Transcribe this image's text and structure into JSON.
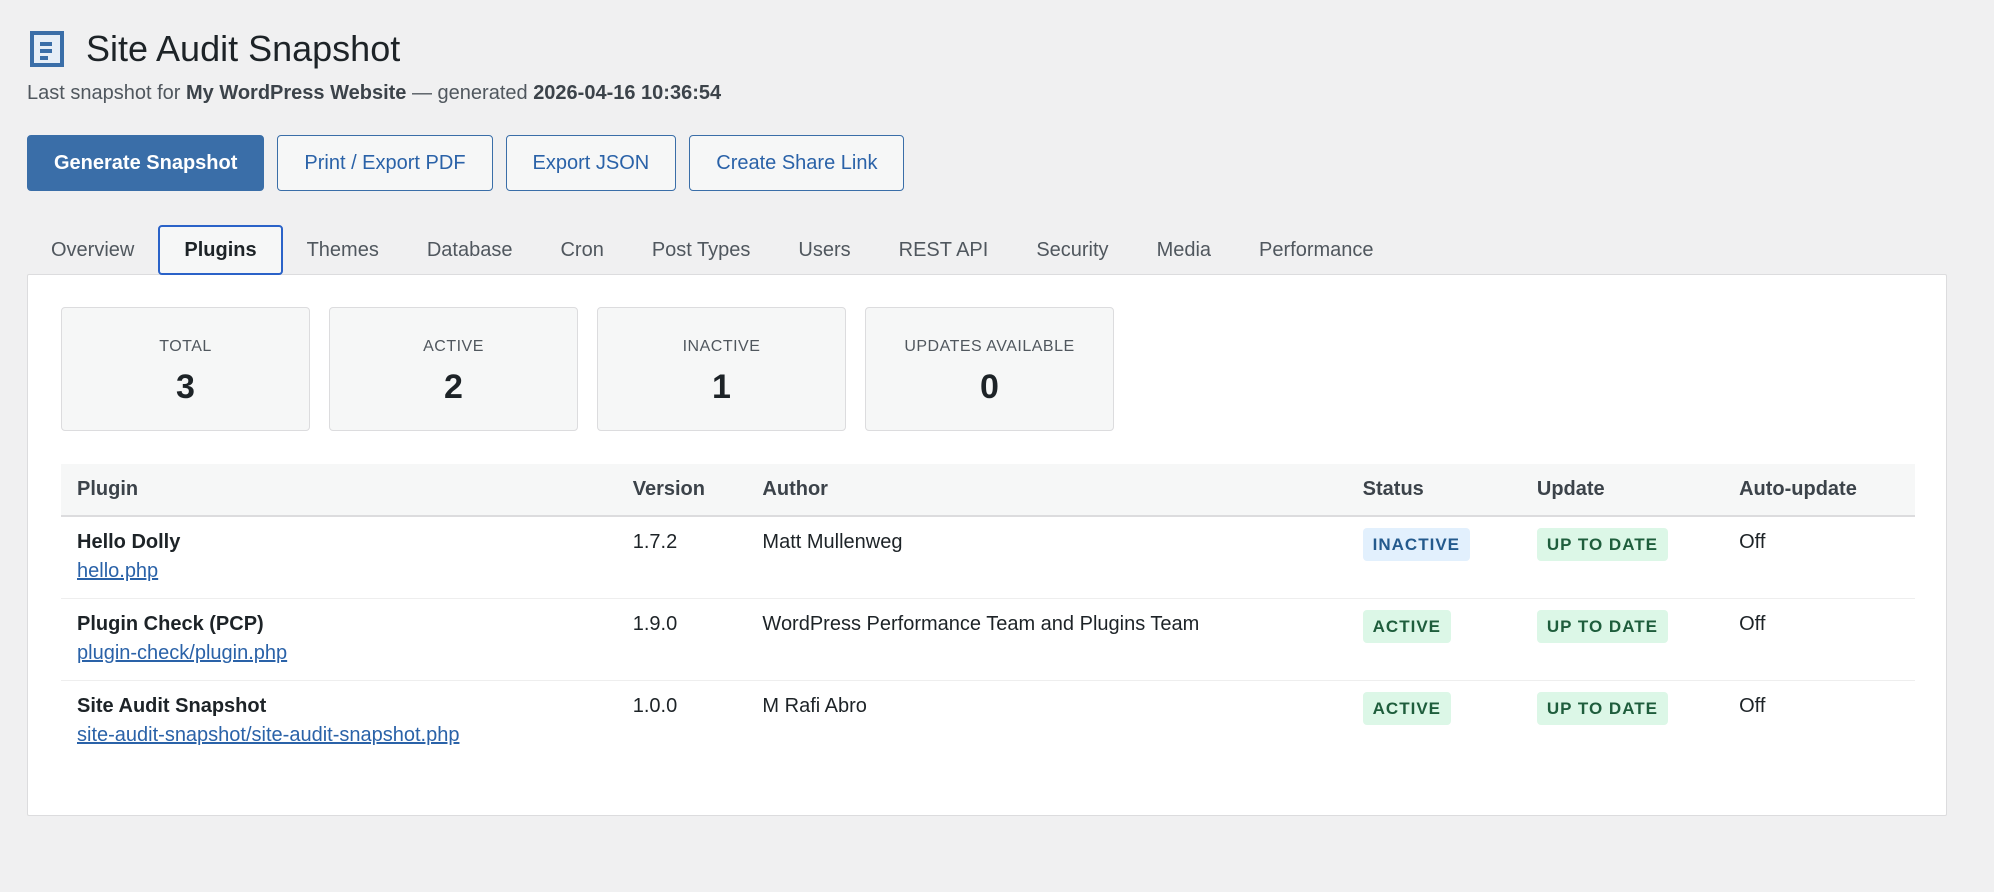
{
  "header": {
    "icon": "document-icon",
    "title": "Site Audit Snapshot",
    "subtitle_prefix": "Last snapshot for ",
    "site_name": "My WordPress Website",
    "subtitle_mid": " — generated ",
    "generated": "2026-04-16 10:36:54"
  },
  "actions": {
    "generate": "Generate Snapshot",
    "print": "Print / Export PDF",
    "export_json": "Export JSON",
    "share": "Create Share Link"
  },
  "tabs": [
    "Overview",
    "Plugins",
    "Themes",
    "Database",
    "Cron",
    "Post Types",
    "Users",
    "REST API",
    "Security",
    "Media",
    "Performance"
  ],
  "stats": [
    {
      "label": "TOTAL",
      "value": "3"
    },
    {
      "label": "ACTIVE",
      "value": "2"
    },
    {
      "label": "INACTIVE",
      "value": "1"
    },
    {
      "label": "UPDATES AVAILABLE",
      "value": "0"
    }
  ],
  "table": {
    "headers": [
      "Plugin",
      "Version",
      "Author",
      "Status",
      "Update",
      "Auto-update"
    ],
    "rows": [
      {
        "name": "Hello Dolly",
        "file": "hello.php",
        "version": "1.7.2",
        "author": "Matt Mullenweg",
        "status": "INACTIVE",
        "update": "UP TO DATE",
        "auto": "Off"
      },
      {
        "name": "Plugin Check (PCP)",
        "file": "plugin-check/plugin.php",
        "version": "1.9.0",
        "author": "WordPress Performance Team and Plugins Team",
        "status": "ACTIVE",
        "update": "UP TO DATE",
        "auto": "Off"
      },
      {
        "name": "Site Audit Snapshot",
        "file": "site-audit-snapshot/site-audit-snapshot.php",
        "version": "1.0.0",
        "author": "M Rafi Abro",
        "status": "ACTIVE",
        "update": "UP TO DATE",
        "auto": "Off"
      }
    ]
  },
  "colors": {
    "accent": "#3a6ea8",
    "inactive_bg": "#e2f0fd",
    "active_bg": "#dcf7e7"
  }
}
